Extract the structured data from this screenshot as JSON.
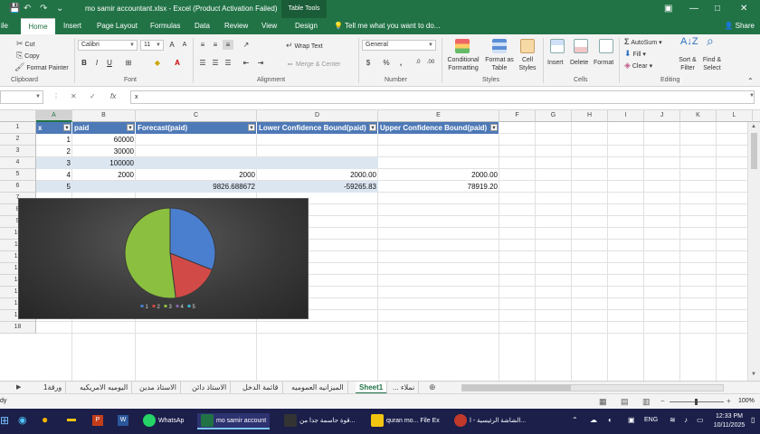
{
  "titlebar": {
    "title": "mo samir accountant.xlsx - Excel (Product Activation Failed)",
    "table_tools": "Table Tools",
    "min": "—",
    "max": "□",
    "close": "✕",
    "ribbon_opts": "▣"
  },
  "tabs": [
    {
      "label": "ile"
    },
    {
      "label": "Home"
    },
    {
      "label": "Insert"
    },
    {
      "label": "Page Layout"
    },
    {
      "label": "Formulas"
    },
    {
      "label": "Data"
    },
    {
      "label": "Review"
    },
    {
      "label": "View"
    },
    {
      "label": "Design"
    }
  ],
  "tell_me": "Tell me what you want to do...",
  "share": "Share",
  "ribbon": {
    "cut": "Cut",
    "copy": "Copy",
    "format_painter": "Format Painter",
    "font_name": "Calibri",
    "font_size": "11",
    "bold": "B",
    "italic": "I",
    "underline": "U",
    "wrap_text": "Wrap Text",
    "merge_center": "Merge & Center",
    "number_format": "General",
    "currency": "$",
    "percent": "%",
    "comma": ",",
    "conditional_1": "Conditional",
    "conditional_2": "Formatting",
    "format_table_1": "Format as",
    "format_table_2": "Table",
    "cell_styles_1": "Cell",
    "cell_styles_2": "Styles",
    "insert": "Insert",
    "delete": "Delete",
    "format": "Format",
    "autosum": "AutoSum",
    "fill": "Fill",
    "clear": "Clear",
    "sort_1": "Sort &",
    "sort_2": "Filter",
    "find_1": "Find &",
    "find_2": "Select",
    "groups": {
      "clipboard": "Clipboard",
      "font": "Font",
      "alignment": "Alignment",
      "number": "Number",
      "styles": "Styles",
      "cells": "Cells",
      "editing": "Editing"
    }
  },
  "formula_bar": {
    "namebox": "",
    "fx": "fx",
    "cancel": "✕",
    "enter": "✓",
    "value": "x"
  },
  "columns": [
    "A",
    "B",
    "C",
    "D",
    "E",
    "F",
    "G",
    "H",
    "I",
    "J",
    "K",
    "L",
    "M",
    "N",
    "O"
  ],
  "rows": [
    "1",
    "2",
    "3",
    "4",
    "5",
    "6",
    "7",
    "8",
    "9",
    "10",
    "11",
    "12",
    "13",
    "14",
    "15",
    "16",
    "17",
    "18"
  ],
  "table": {
    "headers": [
      "x",
      "paid",
      "Forecast(paid)",
      "Lower Confidence Bound(paid)",
      "Upper Confidence Bound(paid)"
    ],
    "rows": [
      [
        "1",
        "60000",
        "",
        "",
        ""
      ],
      [
        "2",
        "30000",
        "",
        "",
        ""
      ],
      [
        "3",
        "100000",
        "",
        "",
        ""
      ],
      [
        "4",
        "2000",
        "2000",
        "2000.00",
        "2000.00"
      ],
      [
        "5",
        "",
        "9826.688672",
        "-59265.83",
        "78919.20"
      ]
    ]
  },
  "chart_data": {
    "type": "pie",
    "categories": [
      "1",
      "2",
      "3",
      "4",
      "5"
    ],
    "values": [
      0.31,
      0.17,
      0.52,
      0,
      0
    ],
    "legend": "bottom",
    "colors": [
      "#4a7fd0",
      "#d24a47",
      "#8bbf3f",
      "#8a64b0",
      "#3fb6cf"
    ]
  },
  "sheets": [
    {
      "label": "ورقة1"
    },
    {
      "label": "اليوميه الامريكيه"
    },
    {
      "label": "الاستاذ مدين"
    },
    {
      "label": "الاستاذ دائن"
    },
    {
      "label": "قائمة الدخل"
    },
    {
      "label": "الميزانيه العموميه"
    },
    {
      "label": "Sheet1"
    },
    {
      "label": "... نملاء"
    }
  ],
  "status": {
    "ready": "dy",
    "zoom": "100%"
  },
  "taskbar": {
    "whatsapp": "WhatsAp",
    "excel": "mo samir account",
    "notes": "قوة حاسمة جدا من...",
    "pdf": "quran mo... File Ex",
    "home": "الشاشة الرئيسية - ا...",
    "lang": "ENG",
    "time": "12:33 PM",
    "date": "10/11/2025"
  }
}
